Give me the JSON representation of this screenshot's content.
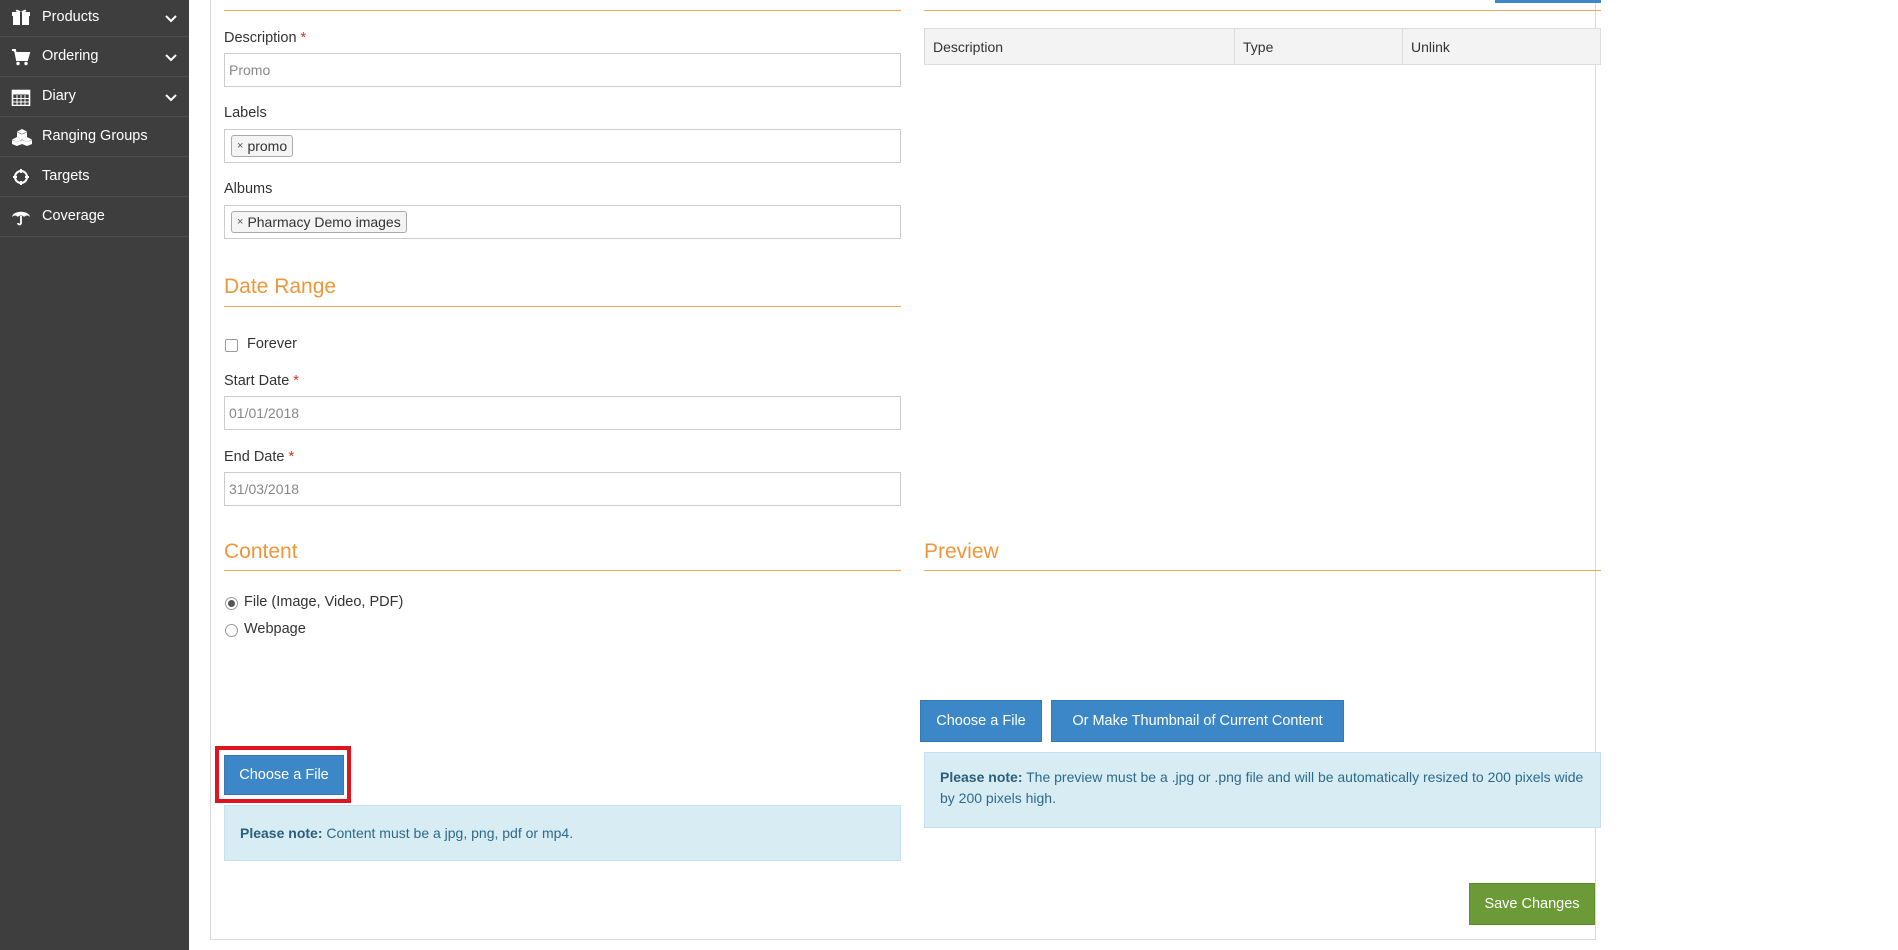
{
  "sidebar": {
    "items": [
      {
        "label": "Products",
        "icon": "gift-icon",
        "has_chevron": true
      },
      {
        "label": "Ordering",
        "icon": "cart-icon",
        "has_chevron": true
      },
      {
        "label": "Diary",
        "icon": "calendar-icon",
        "has_chevron": true
      },
      {
        "label": "Ranging Groups",
        "icon": "cubes-icon",
        "has_chevron": false
      },
      {
        "label": "Targets",
        "icon": "crosshair-icon",
        "has_chevron": false
      },
      {
        "label": "Coverage",
        "icon": "umbrella-icon",
        "has_chevron": false
      }
    ]
  },
  "general": {
    "description_label": "Description",
    "description_placeholder": "Promo",
    "labels_label": "Labels",
    "labels_tags": [
      "promo"
    ],
    "albums_label": "Albums",
    "albums_tags": [
      "Pharmacy Demo images"
    ],
    "required_mark": "*",
    "tag_remove": "×"
  },
  "date_range": {
    "title": "Date Range",
    "forever_label": "Forever",
    "start_label": "Start Date",
    "start_placeholder": "01/01/2018",
    "end_label": "End Date",
    "end_placeholder": "31/03/2018"
  },
  "links": {
    "columns": [
      "Description",
      "Type",
      "Unlink"
    ]
  },
  "content": {
    "title": "Content",
    "option_file": "File (Image, Video, PDF)",
    "option_webpage": "Webpage",
    "selected": "file",
    "choose_button": "Choose a File",
    "note_bold": "Please note:",
    "note_text": "Content must be a jpg, png, pdf or mp4."
  },
  "preview": {
    "title": "Preview",
    "choose_button": "Choose a File",
    "thumbnail_button": "Or Make Thumbnail of Current Content",
    "note_bold": "Please note:",
    "note_text": "The preview must be a .jpg or .png file and will be automatically resized to 200 pixels wide by 200 pixels high."
  },
  "actions": {
    "save_button": "Save Changes"
  },
  "colors": {
    "sidebar_bg": "#3e3e3e",
    "accent_orange": "#f0963a",
    "button_blue": "#3c87c8",
    "button_green": "#6b9a36",
    "note_bg": "#d8ecf4",
    "highlight_red": "#e0141e"
  }
}
